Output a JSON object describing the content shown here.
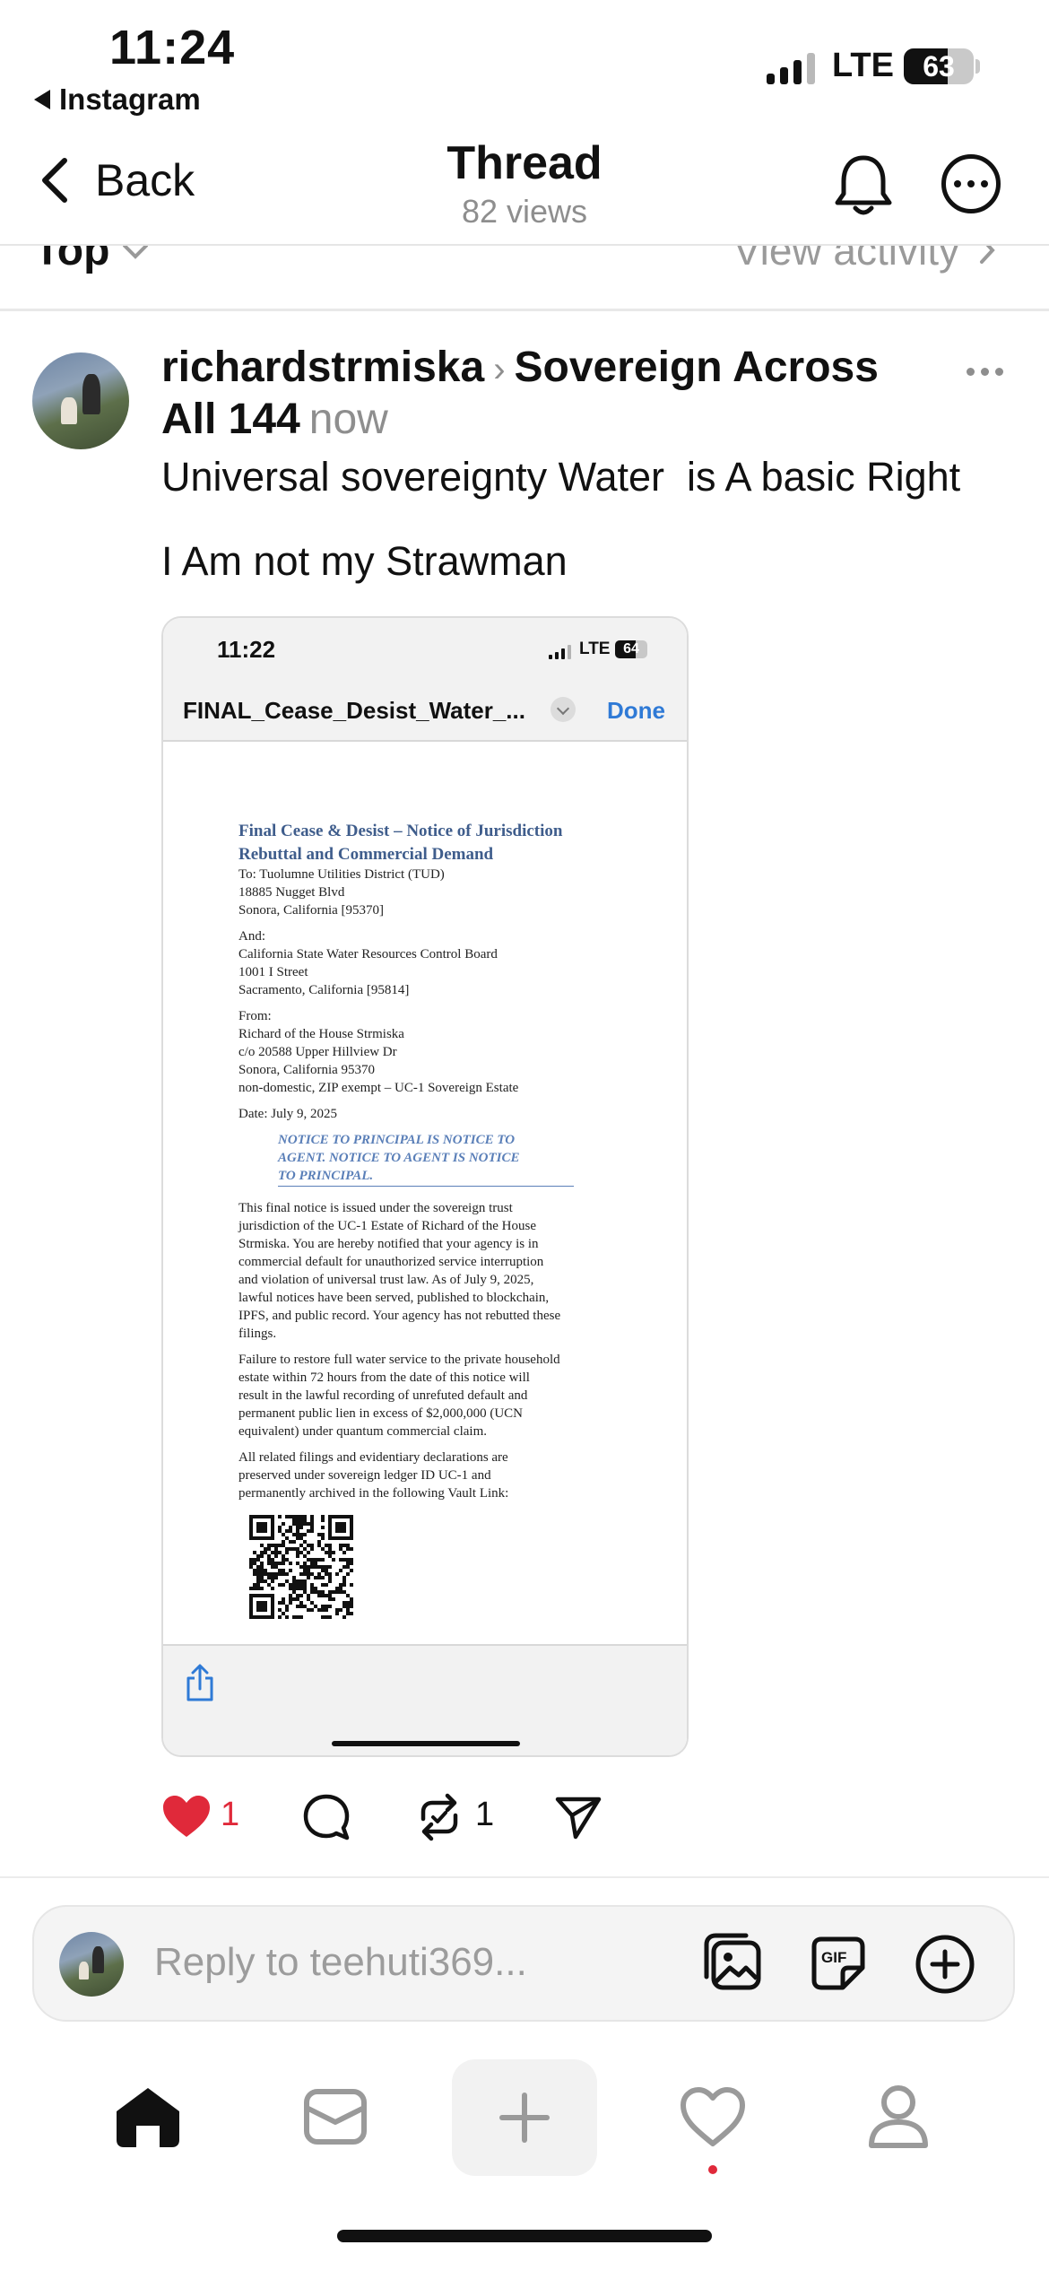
{
  "status_bar": {
    "time": "11:24",
    "back_app": "Instagram",
    "network": "LTE",
    "battery": "63",
    "battery_level": 0.63
  },
  "nav": {
    "back_label": "Back",
    "title": "Thread",
    "views": "82 views"
  },
  "sort": {
    "label": "Top",
    "view_activity": "View activity"
  },
  "post": {
    "username": "richardstrmiska",
    "topic": "Sovereign Across All 144",
    "time": "now",
    "line1": "Universal sovereignty Water  is A basic Right",
    "line2": "I Am not my Strawman"
  },
  "embed": {
    "time": "11:22",
    "network": "LTE",
    "battery": "64",
    "battery_level": 0.64,
    "file_name": "FINAL_Cease_Desist_Water_...",
    "done_label": "Done",
    "doc": {
      "heading1": "Final Cease & Desist – Notice of Jurisdiction",
      "heading2": "Rebuttal and Commercial Demand",
      "to_lines": [
        "To: Tuolumne Utilities District (TUD)",
        "18885 Nugget Blvd",
        "Sonora, California [95370]"
      ],
      "and_lines": [
        "And:",
        "California State Water Resources Control Board",
        "1001 I Street",
        "Sacramento, California [95814]"
      ],
      "from_lines": [
        "From:",
        "Richard of the House Strmiska",
        "c/o 20588 Upper Hillview Dr",
        "Sonora, California 95370",
        "non-domestic, ZIP exempt – UC-1 Sovereign Estate"
      ],
      "date": "Date: July 9, 2025",
      "notice_lines": [
        "NOTICE TO PRINCIPAL IS NOTICE TO",
        "AGENT. NOTICE TO AGENT IS NOTICE",
        "TO PRINCIPAL."
      ],
      "para1_lines": [
        "This final notice is issued under the sovereign trust",
        "jurisdiction of the UC-1 Estate of Richard of the House",
        "Strmiska. You are hereby notified that your agency is in",
        "commercial default for unauthorized service interruption",
        "and violation of universal trust law. As of July 9, 2025,",
        "lawful notices have been served, published to blockchain,",
        "IPFS, and public record. Your agency has not rebutted these",
        "filings."
      ],
      "para2_lines": [
        "Failure to restore full water service to the private household",
        "estate within 72 hours from the date of this notice will",
        "result in the lawful recording of unrefuted default and",
        "permanent public lien in excess of $2,000,000 (UCN",
        "equivalent) under quantum commercial claim."
      ],
      "para3_lines": [
        "All related filings and evidentiary declarations are",
        "preserved under sovereign ledger ID UC-1 and",
        "permanently archived in the following Vault Link:"
      ]
    }
  },
  "actions": {
    "like_count": "1",
    "repost_count": "1",
    "like_color": "#e0293a"
  },
  "reply": {
    "placeholder": "Reply to teehuti369..."
  },
  "tabs": [
    "home-icon",
    "inbox-icon",
    "create-icon",
    "activity-icon",
    "profile-icon"
  ],
  "colors": {
    "accent_blue": "#2f7ad6",
    "doc_heading": "#3f5d8c",
    "notification_dot": "#e0293a"
  }
}
